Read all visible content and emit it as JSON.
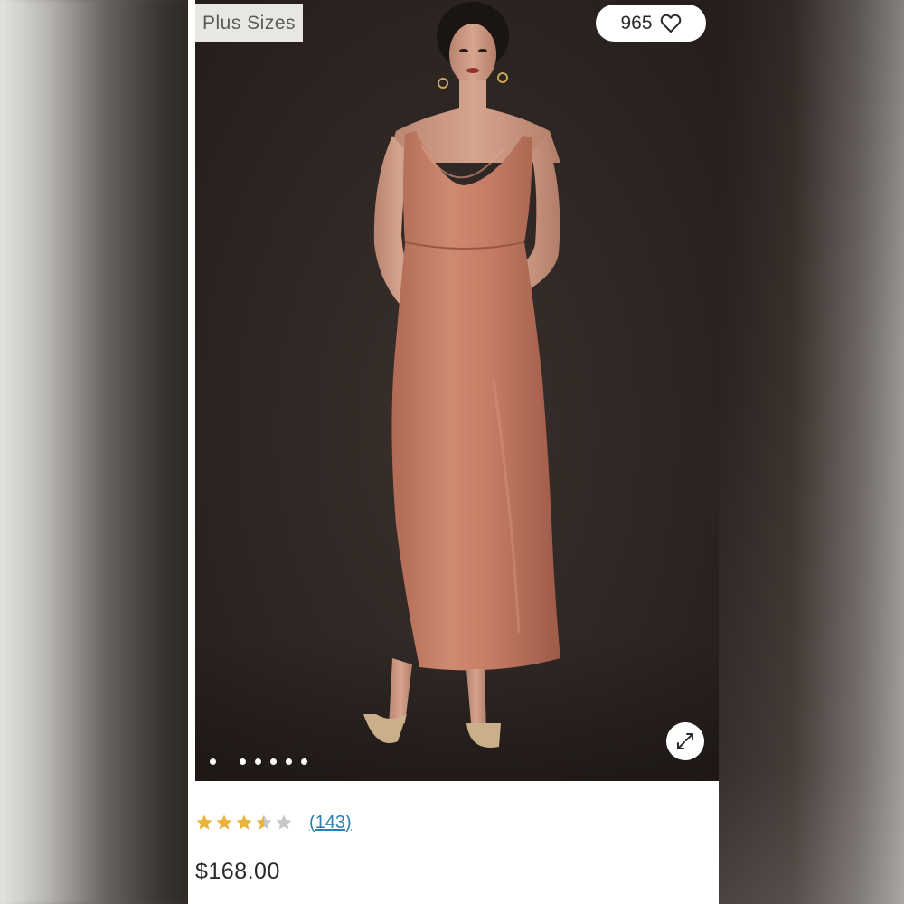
{
  "product": {
    "tag": "Plus Sizes",
    "likes": "965",
    "rating": 3.5,
    "rating_max": 5,
    "review_count": "(143)",
    "price": "$168.00"
  },
  "gallery": {
    "image_count": 6,
    "active_index": 0,
    "image_subject": "woman wearing a rose satin cowl-neck slip maxi dress"
  },
  "icons": {
    "like": "heart-outline-icon",
    "expand": "expand-arrows-icon",
    "star": "star-icon"
  },
  "colors": {
    "star_fill": "#e9b43a",
    "star_empty": "#c8c8c8",
    "link": "#2f7fae",
    "dress": "#c98067",
    "backdrop": "#2e2623"
  }
}
